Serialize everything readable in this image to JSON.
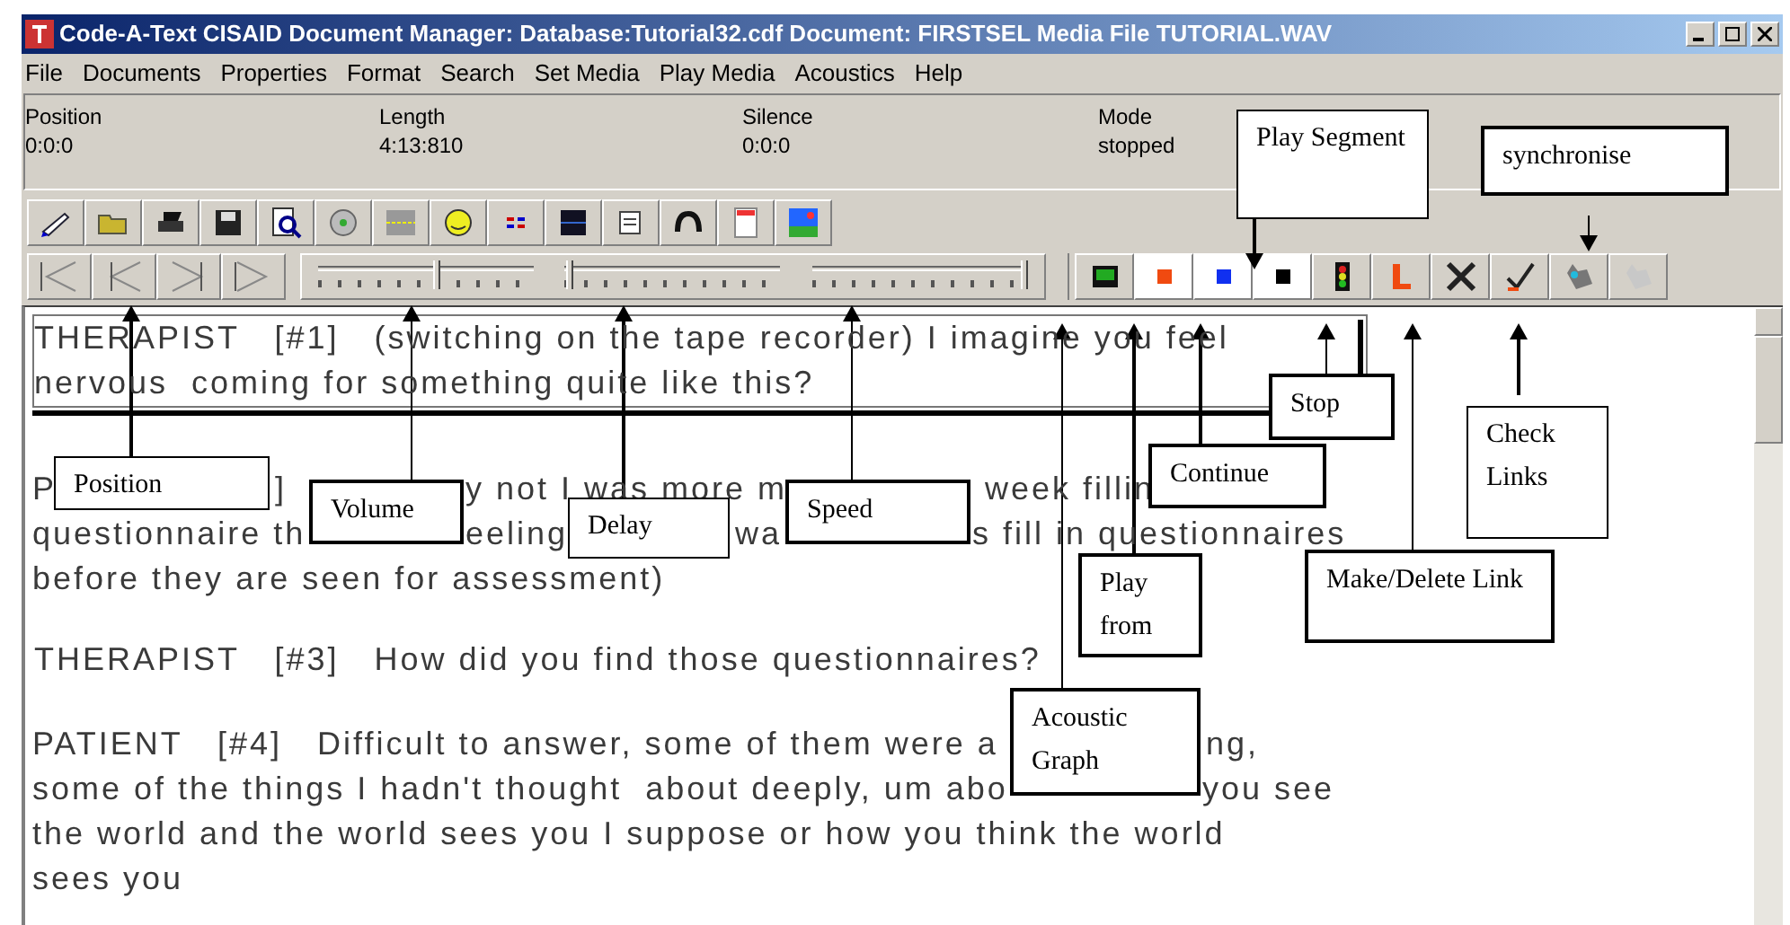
{
  "window": {
    "title": "Code-A-Text CISAID Document Manager: Database:Tutorial32.cdf Document: FIRSTSEL  Media File TUTORIAL.WAV"
  },
  "menu": [
    {
      "label": "File"
    },
    {
      "label": "Documents"
    },
    {
      "label": "Properties"
    },
    {
      "label": "Format"
    },
    {
      "label": "Search"
    },
    {
      "label": "Set Media"
    },
    {
      "label": "Play Media"
    },
    {
      "label": "Acoustics"
    },
    {
      "label": "Help"
    }
  ],
  "status": [
    {
      "label": "Position",
      "value": "0:0:0"
    },
    {
      "label": "Length",
      "value": "4:13:810"
    },
    {
      "label": "Silence",
      "value": "0:0:0"
    },
    {
      "label": "Mode",
      "value": "stopped"
    }
  ],
  "sliders": [
    {
      "level": 0.55
    },
    {
      "level": 0.02
    },
    {
      "level": 0.98
    }
  ],
  "transcript": [
    {
      "kind": "selected",
      "lines": [
        [
          "THERAPIST   [#1]   (switching on the tape recorder) I imagine you feel"
        ],
        [
          "nervous  coming for something quite like this?"
        ]
      ]
    },
    {
      "kind": "covered",
      "lines": [
        [
          "P",
          "]",
          "y not I was more m",
          "week fillin"
        ],
        [
          "questionnaire th",
          "eeling",
          "wa",
          "s fill in questionnaires"
        ],
        [
          "before they are seen for assessment)"
        ]
      ]
    },
    {
      "kind": "plain",
      "lines": [
        [
          "THERAPIST   [#3]   How did you find those questionnaires?"
        ]
      ]
    },
    {
      "kind": "covered",
      "lines": [
        [
          "PATIENT   [#4]   Difficult to answer, some of them were a",
          "ng,"
        ],
        [
          "some of the things I hadn't thought  about deeply, um abo",
          "you see"
        ],
        [
          "the world and the world sees you I suppose or how you think the world"
        ],
        [
          "sees you"
        ]
      ]
    }
  ],
  "callouts": [
    {
      "text": "Play Segment"
    },
    {
      "text": "synchronise"
    },
    {
      "text": "Stop"
    },
    {
      "text": "Position"
    },
    {
      "text": "Volume"
    },
    {
      "text": "Delay"
    },
    {
      "text": "Speed"
    },
    {
      "text": "Continue"
    },
    {
      "text": "Check Links"
    },
    {
      "text": "Play from"
    },
    {
      "text": "Make/Delete Link"
    },
    {
      "text": "Acoustic Graph"
    }
  ]
}
